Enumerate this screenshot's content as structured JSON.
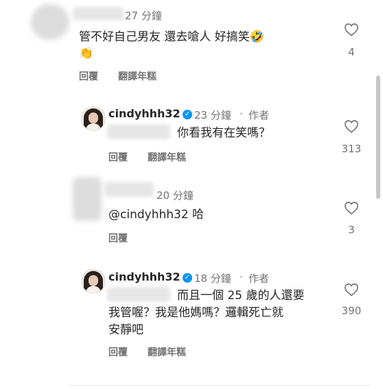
{
  "comments": [
    {
      "time": "27 分鐘",
      "text_line1": "管不好自己男友 還去嗆人 好搞笑🤣",
      "text_line2": "👏",
      "reply": "回覆",
      "translate": "翻譯年糕",
      "likes": "4"
    },
    {
      "username": "cindyhhh32",
      "time": "23 分鐘",
      "author_label": "作者",
      "text": "你看我有在笑嗎？",
      "reply": "回覆",
      "translate": "翻譯年糕",
      "likes": "313"
    },
    {
      "time": "20 分鐘",
      "text": "@cindyhhh32 哈",
      "reply": "回覆",
      "likes": "3"
    },
    {
      "username": "cindyhhh32",
      "time": "18 分鐘",
      "author_label": "作者",
      "text_line1": "而且一個 25 歲的人還要",
      "text_line2": "我管喔？我是他媽嗎？邏輯死亡就",
      "text_line3": "安靜吧",
      "reply": "回覆",
      "translate": "翻譯年糕",
      "likes": "390"
    }
  ],
  "icons": {
    "like": "heart-icon",
    "verified": "verified-badge-icon"
  }
}
